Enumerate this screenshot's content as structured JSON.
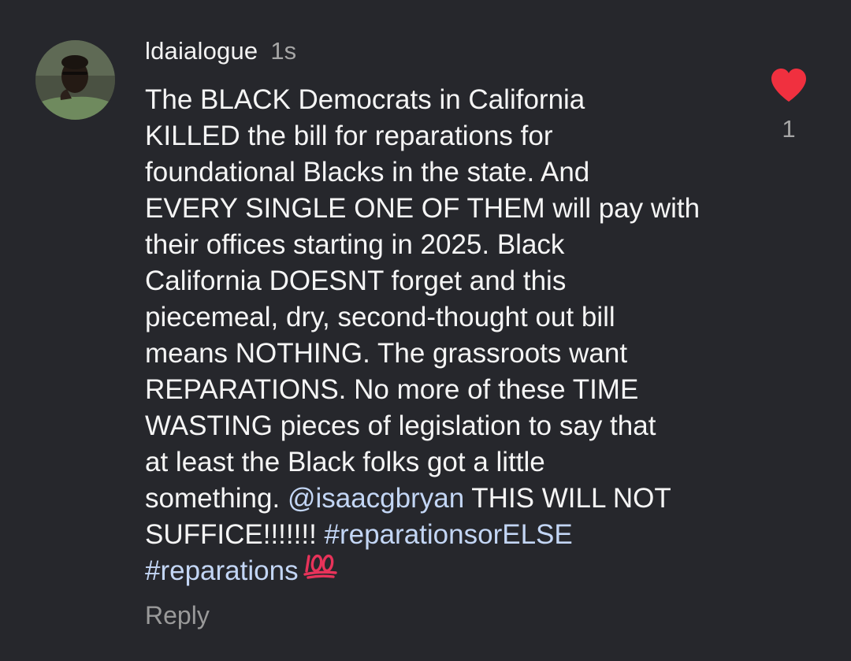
{
  "comment": {
    "username": "ldaialogue",
    "timestamp": "1s",
    "lines": [
      "The BLACK Democrats in California",
      "KILLED the bill for reparations for",
      "foundational Blacks in the state. And",
      "EVERY SINGLE ONE OF THEM will pay with",
      "their offices starting in 2025. Black",
      "California DOESNT forget and this",
      "piecemeal, dry, second-thought out bill",
      "means NOTHING. The grassroots want",
      "REPARATIONS. No more of these TIME",
      "WASTING pieces of legislation to say that",
      "at least the Black folks got a little"
    ],
    "line12_pre": "something. ",
    "mention": "@isaacgbryan",
    "line12_post": " THIS WILL NOT",
    "line13_pre": "SUFFICE!!!!!!! ",
    "hashtag1": "#reparationsorELSE",
    "hashtag2": "#reparations",
    "emoji": "hundred-points-icon",
    "reply_label": "Reply"
  },
  "likes": {
    "count": "1",
    "icon": "heart-icon",
    "liked": true,
    "heart_color": "#f0303f"
  },
  "colors": {
    "background": "#26272c",
    "text": "#f5f5f5",
    "muted": "#a6a6a6",
    "link": "#c3d6f5"
  }
}
